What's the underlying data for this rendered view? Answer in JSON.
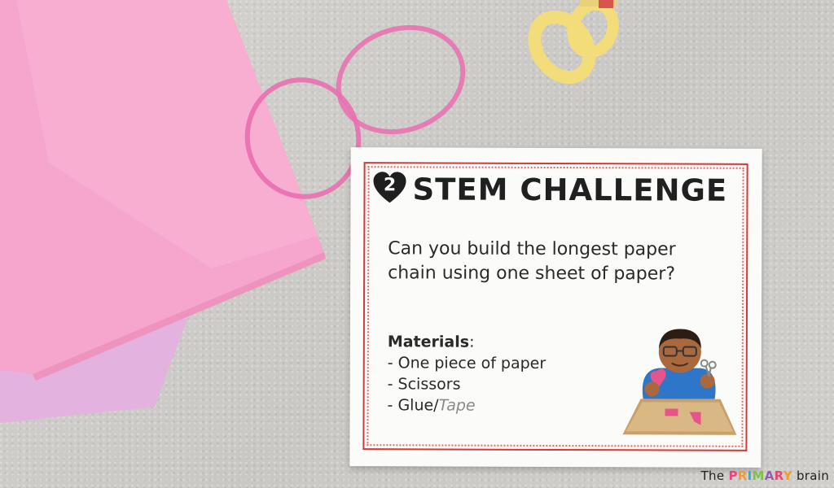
{
  "card": {
    "number": "2",
    "title": "STEM CHALLENGE",
    "question_line1": "Can you build the longest paper",
    "question_line2": "chain using one sheet of paper?",
    "materials_header": "Materials",
    "materials_colon": ":",
    "items": [
      "- One piece of paper",
      "- Scissors",
      "- Glue/"
    ],
    "item3_suffix": "Tape"
  },
  "watermark": {
    "prefix": "The ",
    "highlight": "PRIMARY",
    "suffix": " brain",
    "highlight_colors": [
      "#e8457a",
      "#f39a2b",
      "#3aa6d8",
      "#7cc243",
      "#9b59b6",
      "#e8457a",
      "#f39a2b"
    ]
  },
  "colors": {
    "paper_pink": "#f7a9cf",
    "paper_lavender": "#e7b4e0",
    "ribbon": "#e96fb0",
    "scissors": "#f4df7e",
    "card_border": "#d23a3a"
  },
  "icons": [
    "heart-number-icon",
    "boy-with-scissors-illustration",
    "scissors-object",
    "ribbon-curl"
  ]
}
